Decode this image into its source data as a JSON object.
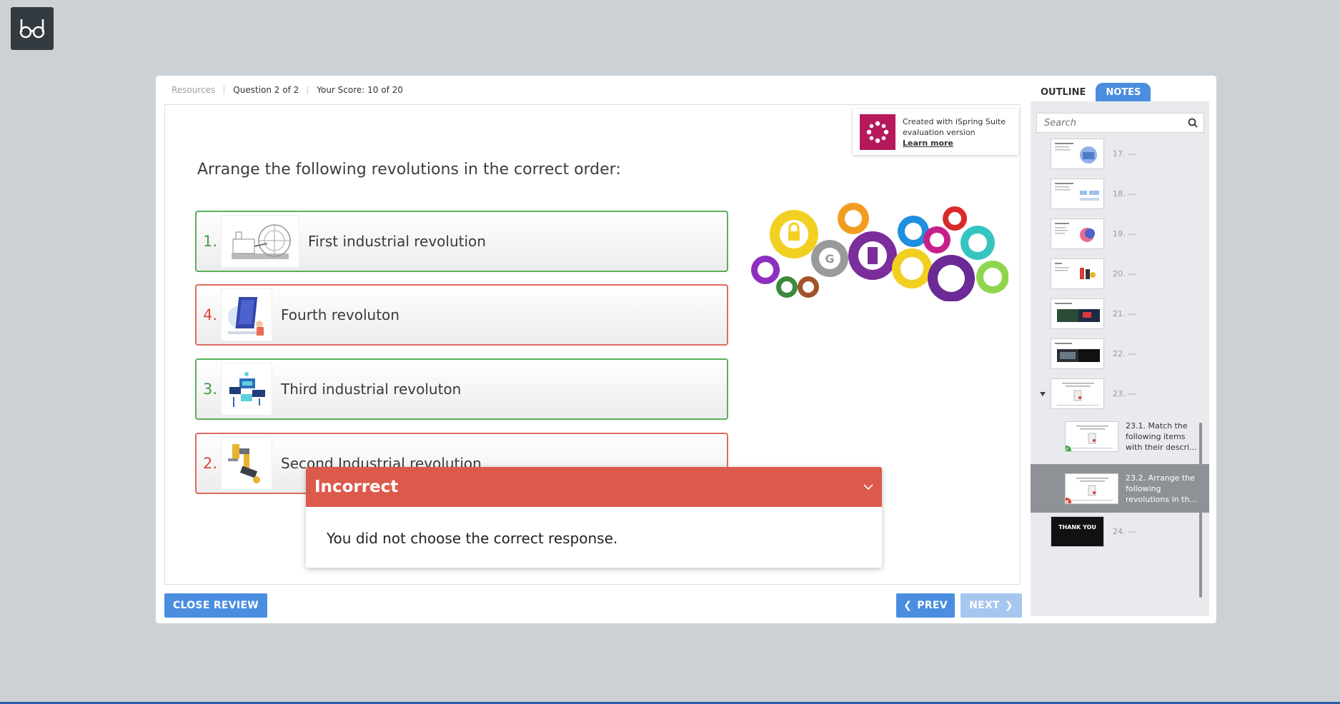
{
  "top": {
    "resources": "Resources",
    "question": "Question 2 of 2",
    "score": "Your Score: 10 of 20"
  },
  "ispring": {
    "line1": "Created with iSpring Suite",
    "line2": "evaluation version",
    "learn": "Learn more"
  },
  "question_text": "Arrange the following revolutions in the correct order:",
  "items": [
    {
      "num": "1.",
      "label": "First industrial revolution",
      "status": "correct"
    },
    {
      "num": "4.",
      "label": "Fourth revoluton",
      "status": "incorrect"
    },
    {
      "num": "3.",
      "label": "Third industrial revoluton",
      "status": "correct"
    },
    {
      "num": "2.",
      "label": "Second Industrial revolution",
      "status": "incorrect"
    }
  ],
  "feedback": {
    "title": "Incorrect",
    "message": "You did not choose the correct response."
  },
  "buttons": {
    "close_review": "CLOSE REVIEW",
    "prev": "PREV",
    "next": "NEXT"
  },
  "sidebar": {
    "tabs": [
      "OUTLINE",
      "NOTES"
    ],
    "search_placeholder": "Search",
    "slides": [
      {
        "label": "17. ---"
      },
      {
        "label": "18. ---"
      },
      {
        "label": "19. ---"
      },
      {
        "label": "20. ---"
      },
      {
        "label": "21. ---"
      },
      {
        "label": "22. ---"
      },
      {
        "label": "23. ---"
      },
      {
        "label": "23.1. Match the following items with their descri...",
        "status": "correct"
      },
      {
        "label": "23.2.  Arrange the following revolutions in th...",
        "status": "incorrect"
      },
      {
        "label": "24. ---",
        "thumb_text": "THANK YOU"
      }
    ]
  },
  "colors": {
    "accent": "#4b8ee0",
    "correct": "#58b05c",
    "incorrect": "#dc5a4c",
    "brand": "#b6195b"
  }
}
